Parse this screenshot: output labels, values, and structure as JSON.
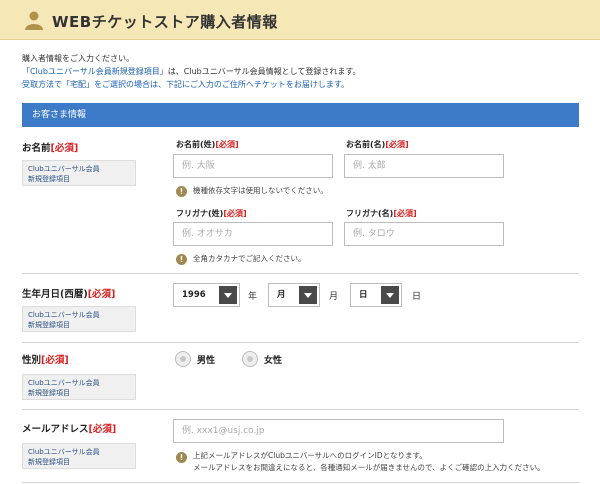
{
  "header": {
    "title": "WEBチケットストア購入者情報",
    "icon": "person-icon"
  },
  "intro": {
    "line1": "購入者情報をご入力ください。",
    "line2_link": "「Clubユニバーサル会員新規登録項目」",
    "line2_tail": "は、Clubユニバーサル会員情報として登録されます。",
    "line3": "受取方法で「宅配」をご選択の場合は、下記にご入力のご住所へチケットをお届けします。"
  },
  "section": {
    "title": "お客さま情報"
  },
  "required_text": "[必須]",
  "club_badge": {
    "line1": "Clubユニバーサル会員",
    "line2": "新規登録項目"
  },
  "name_row": {
    "label": "お名前",
    "last_label": "お名前(姓)",
    "first_label": "お名前(名)",
    "last_placeholder": "例. 大阪",
    "first_placeholder": "例. 太郎",
    "note1": "機種依存文字は使用しないでください。",
    "kana_last_label": "フリガナ(姓)",
    "kana_first_label": "フリガナ(名)",
    "kana_last_placeholder": "例. オオサカ",
    "kana_first_placeholder": "例. タロウ",
    "note2": "全角カタカナでご記入ください。"
  },
  "birth_row": {
    "label": "生年月日(西暦)",
    "year_value": "1996",
    "year_unit": "年",
    "month_value": "月",
    "month_unit": "月",
    "day_value": "日",
    "day_unit": "日"
  },
  "gender_row": {
    "label": "性別",
    "option_male": "男性",
    "option_female": "女性"
  },
  "email_row": {
    "label": "メールアドレス",
    "placeholder": "例. xxx1@usj.co.jp",
    "note_line1": "上記メールアドレスがClubユニバーサルへのログインIDとなります。",
    "note_line2": "メールアドレスをお間違えになると、各種通知メールが届きませんので、よくご確認の上入力ください。"
  },
  "colors": {
    "header_bg": "#f6e7b6",
    "section_bar": "#3d7ac8",
    "required": "#d52020",
    "link": "#1a5fb4"
  }
}
